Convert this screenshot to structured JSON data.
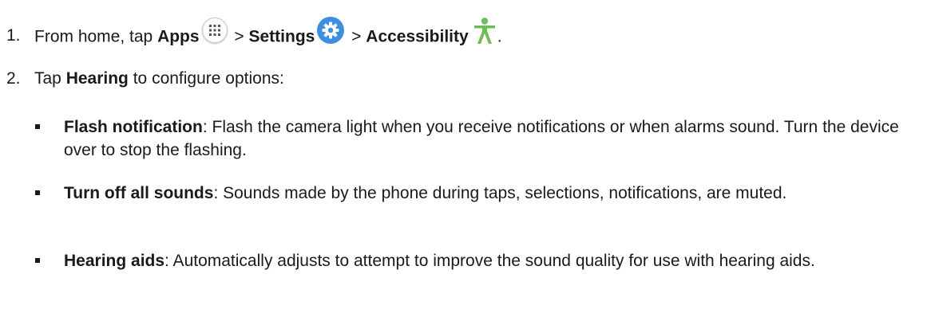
{
  "steps": [
    {
      "number": "1.",
      "parts": {
        "t1": "From home, tap ",
        "apps": "Apps",
        "sep1": " > ",
        "settings": "Settings",
        "sep2": " > ",
        "accessibility": "Accessibility",
        "end": "."
      },
      "icons": [
        "apps-grid-icon",
        "settings-gear-icon",
        "accessibility-person-icon"
      ]
    },
    {
      "number": "2.",
      "parts": {
        "t1": "Tap ",
        "hearing": "Hearing",
        "t2": " to configure options:"
      }
    }
  ],
  "options": [
    {
      "title": "Flash notification",
      "desc": ": Flash the camera light when you receive notifications or when alarms sound. Turn the device over to stop the flashing."
    },
    {
      "title": "Turn off all sounds",
      "desc": ": Sounds made by the phone during taps, selections, notifications, are muted."
    },
    {
      "title": "Hearing aids",
      "desc": ": Automatically adjusts to attempt to improve the sound quality for use with hearing aids."
    }
  ],
  "colors": {
    "text": "#1a1a1a",
    "settings_icon_bg": "#3d8fe0",
    "accessibility_icon": "#6abf5a"
  }
}
